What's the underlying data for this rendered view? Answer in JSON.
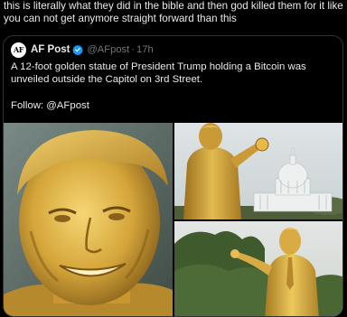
{
  "post": {
    "text": "this is literally what they did in the bible and then god killed them for it like you can not get anymore straight forward than this"
  },
  "quote": {
    "avatar_text": "AF",
    "name": "AF Post",
    "verified_icon": "verified-badge-icon",
    "handle": "@AFpost",
    "separator": "·",
    "time": "17h",
    "body": "A 12-foot golden statue of President Trump holding a Bitcoin was unveiled outside the Capitol on 3rd Street.",
    "follow": "Follow: @AFpost"
  },
  "media": {
    "items": [
      "golden-statue-face-closeup",
      "golden-statue-with-capitol",
      "golden-statue-with-trees"
    ]
  },
  "colors": {
    "background": "#000000",
    "text": "#e7e9ea",
    "muted": "#71767b",
    "border": "#2f3336",
    "verified": "#1d9bf0",
    "gold": "#c9a02c"
  }
}
